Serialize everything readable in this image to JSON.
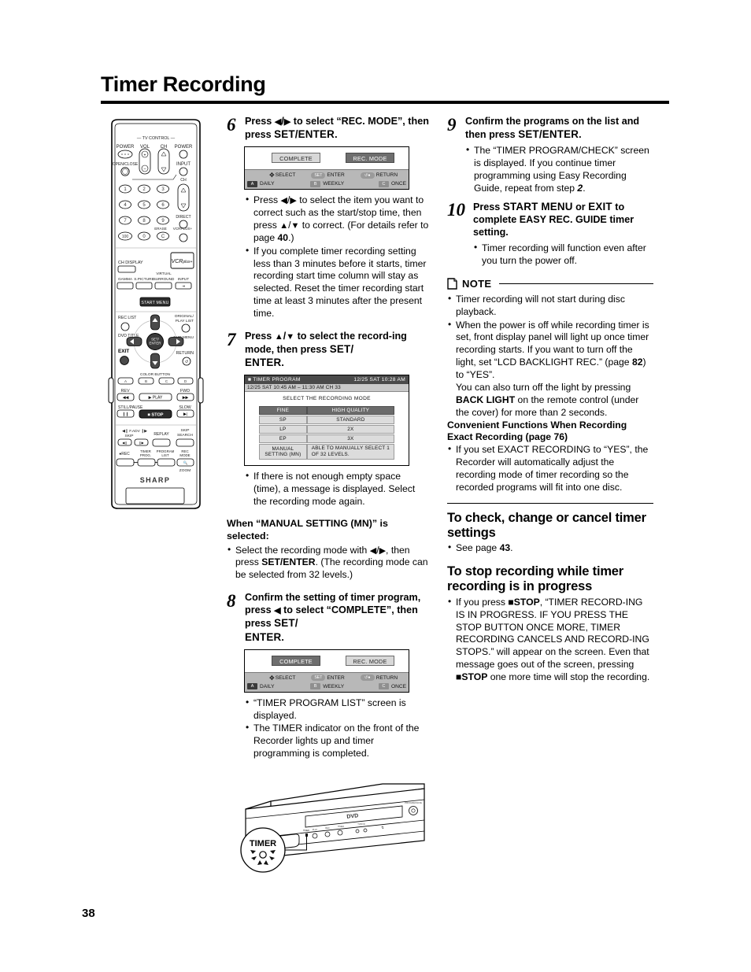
{
  "header": {
    "title": "Timer Recording"
  },
  "page_number": "38",
  "steps": {
    "s6": {
      "num": "6",
      "head_1": "Press ",
      "head_arrows": "◀/▶",
      "head_2": " to select “REC. MODE”, then press ",
      "head_bold": "SET/ENTER",
      "head_end": ".",
      "bullets": [
        "Press ◀/▶ to select the item you want to correct such as the start/stop time, then press ▲/▼ to correct. (For details refer to page 40.)",
        "If you complete timer recording setting less than 3 minutes before it starts, timer recording start time column will stay as selected. Reset the timer recording start time at least 3 minutes after the present time."
      ]
    },
    "s7": {
      "num": "7",
      "head": "Press ▲/▼ to select the recording mode, then press SET/ENTER.",
      "bullets": [
        "If there is not enough empty space (time), a message is displayed. Select the recording mode again."
      ]
    },
    "manual": {
      "heading": "When “MANUAL SETTING (MN)” is selected:",
      "bullets": [
        "Select the recording mode with ◀/▶, then press SET/ENTER. (The recording mode can be selected from 32 levels.)"
      ]
    },
    "s8": {
      "num": "8",
      "head": "Confirm the setting of timer program, press ◀ to select “COMPLETE”, then press SET/ENTER.",
      "bullets": [
        "“TIMER PROGRAM LIST” screen is displayed.",
        "The TIMER indicator on the front of the Recorder lights up and timer programming is completed."
      ]
    },
    "s9": {
      "num": "9",
      "head": "Confirm the programs on the list and then press SET/ENTER.",
      "bullets": [
        "The “TIMER PROGRAM/CHECK” screen is displayed. If you continue timer programming using Easy Recording Guide, repeat from step 2."
      ]
    },
    "s10": {
      "num": "10",
      "head": "Press START MENU or EXIT to complete EASY REC. GUIDE timer setting.",
      "bullets": [
        "Timer recording will function even after you turn the power off."
      ]
    }
  },
  "osd_step6": {
    "complete_label": "COMPLETE",
    "recmode_label": "REC. MODE",
    "complete_state": "off",
    "recmode_state": "on",
    "bar": {
      "select": "SELECT",
      "enter": "ENTER",
      "enter_key": "SET",
      "return": "RETURN",
      "daily": "DAILY",
      "daily_key": "A",
      "weekly": "WEEKLY",
      "weekly_key": "B",
      "once": "ONCE",
      "once_key": "C"
    }
  },
  "osd_step8": {
    "complete_label": "COMPLETE",
    "recmode_label": "REC. MODE",
    "complete_state": "on",
    "recmode_state": "off"
  },
  "osd_step7": {
    "title": "TIMER PROGRAM",
    "clock": "12/25  SAT  10:28  AM",
    "subtitle": "12/25 SAT  10:45 AM –  11:30 AM CH 33",
    "caption": "SELECT THE RECORDING MODE",
    "rows": [
      {
        "mode": "FINE",
        "desc": "HIGH QUALITY",
        "header": true
      },
      {
        "mode": "SP",
        "desc": "STANDARD",
        "header": false
      },
      {
        "mode": "LP",
        "desc": "2X",
        "header": false
      },
      {
        "mode": "EP",
        "desc": "3X",
        "header": false
      },
      {
        "mode": "MANUAL SETTING (MN)",
        "desc": "ABLE TO MANUALLY SELECT 1  OF  32 LEVELS.",
        "header": false
      }
    ]
  },
  "note": {
    "label": "NOTE",
    "bullets": [
      "Timer recording will not start during disc playback.",
      "When the power is off while recording timer is set, front display panel will light up once timer recording starts. If you want to turn off the light, set “LCD BACKLIGHT REC.” (page 82) to “YES”. You can also turn off the light by pressing BACK LIGHT on the remote control (under the cover) for more than 2 seconds."
    ],
    "subhead_line1": "Convenient Functions When Recording",
    "subhead_line2": "Exact Recording (page 76)",
    "subhead_bullets": [
      "If you set EXACT RECORDING to “YES”, the Recorder will automatically adjust the recording mode of timer recording so the recorded programs will fit into one disc."
    ]
  },
  "sections": [
    {
      "heading": "To check, change or cancel timer settings",
      "bullets": [
        "See page 43."
      ]
    },
    {
      "heading": "To stop recording while timer recording is in progress",
      "bullets": [
        "If you press ■STOP, “TIMER RECORDING IS IN PROGRESS. IF YOU PRESS THE STOP BUTTON ONCE MORE, TIMER RECORDING CANCELS AND RECORDING STOPS.” will appear on the screen. Even that message goes out of the screen, pressing ■STOP one more time will stop the recording."
      ]
    }
  ],
  "remote": {
    "tv_control": "— TV CONTROL —",
    "power_left": "POWER",
    "vol": "VOL",
    "ch": "CH",
    "power_right": "POWER",
    "open_close": "OPEN/CLOSE",
    "input": "INPUT",
    "ch2": "CH",
    "direct": "DIRECT",
    "erase": "ERASE",
    "vcrplus": "VCRPLUS+",
    "numbers": [
      "1",
      "2",
      "3",
      "4",
      "5",
      "6",
      "7",
      "8",
      "9",
      "100",
      "0",
      "C"
    ],
    "ch_display": "CH DISPLAY",
    "vcrplus_logo": "VCRplus+",
    "gamma": "GAMMA",
    "s_picture": "S.PICTURE",
    "virtual": "VIRTUAL",
    "surround": "SURROUND",
    "input2": "INPUT",
    "start_menu": "START MENU",
    "rec_list": "REC LIST",
    "dvd_title": "DVD TITLE",
    "original": "ORIGINAL/",
    "play_list": "PLAY LIST",
    "dvd_menu": "DVD MENU",
    "set_enter": "SET/ENTER",
    "exit": "EXIT",
    "return": "RETURN",
    "color_button": "COLOR BUTTON",
    "color_a": "A",
    "color_b": "B",
    "color_c": "C",
    "color_d": "D",
    "rev": "REV",
    "fwd": "FWD",
    "play": "PLAY",
    "still_pause": "STILL/PAUSE",
    "slow": "SLOW",
    "stop": "STOP",
    "fadv": "F.ADV",
    "skip": "SKIP",
    "replay": "REPLAY",
    "skip_search_1": "SKIP",
    "skip_search_2": "SEARCH",
    "rec": "REC",
    "timer_prog_1": "TIMER",
    "timer_prog_2": "PROG.",
    "program_list_1": "PROGRAM",
    "program_list_2": "LIST",
    "rec_mode_1": "REC",
    "rec_mode_2": "MODE",
    "zoom": "ZOOM",
    "brand": "SHARP"
  },
  "recorder": {
    "timer_callout": "TIMER",
    "disc_label": "DVD"
  }
}
